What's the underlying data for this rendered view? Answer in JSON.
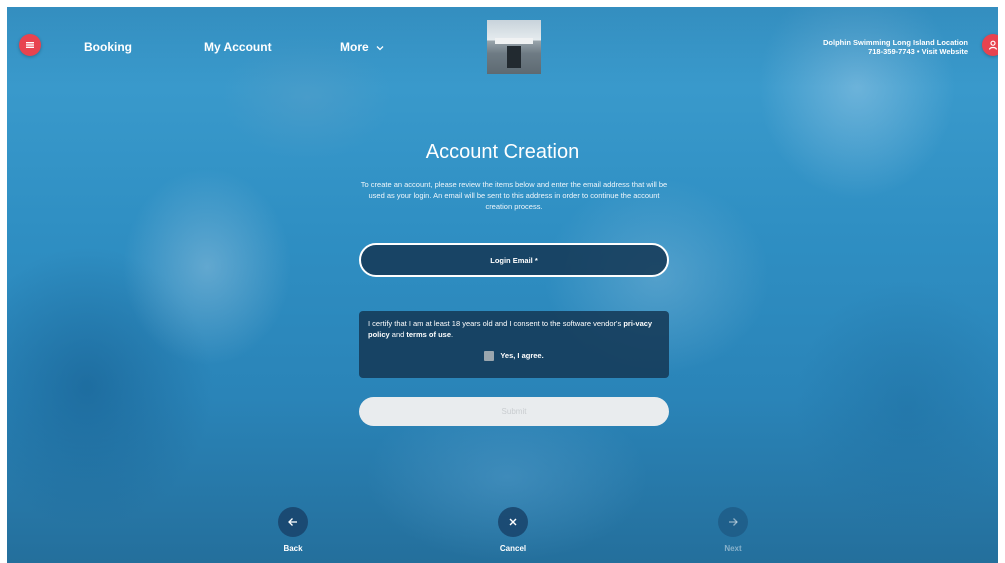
{
  "nav": {
    "booking": "Booking",
    "my_account": "My Account",
    "more": "More"
  },
  "location": {
    "name": "Dolphin Swimming Long Island Location",
    "contact": "718-359-7743 • Visit Website"
  },
  "page": {
    "title": "Account Creation",
    "intro": "To create an account, please review the items below and enter the email address that will be used as your login. An email will be sent to this address in order to continue the account creation process."
  },
  "form": {
    "email_label": "Login Email *",
    "consent_text": "I certify that I am at least 18 years old and I consent to the software vendor's",
    "privacy_link": "pri-vacy policy",
    "and_text": "and",
    "terms_link": "terms of use",
    "period": ".",
    "agree_label": "Yes, I agree.",
    "submit_label": "Submit"
  },
  "bottom_nav": {
    "back": "Back",
    "cancel": "Cancel",
    "next": "Next"
  },
  "colors": {
    "accent": "#e8434f",
    "overlay": "#2f8fc3",
    "panel": "#14374f"
  },
  "icons": {
    "menu": "hamburger-icon",
    "account": "user-icon",
    "more": "chevron-down-icon",
    "back": "arrow-left-icon",
    "cancel": "close-icon",
    "next": "arrow-right-icon"
  }
}
